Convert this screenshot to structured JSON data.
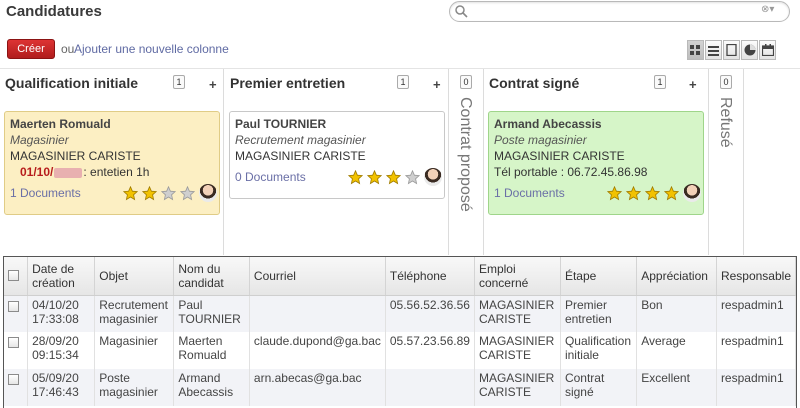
{
  "header": {
    "title": "Candidatures"
  },
  "search": {
    "placeholder": "",
    "dropdown_icon": "⊗▾"
  },
  "toolbar": {
    "create_label": "Créer",
    "or_label": "ou",
    "add_column_label": "Ajouter une nouvelle colonne",
    "views": [
      "kanban-icon",
      "list-icon",
      "form-icon",
      "graph-icon",
      "calendar-icon"
    ]
  },
  "columns": [
    {
      "title": "Qualification initiale",
      "count": "1"
    },
    {
      "title": "Premier entretien",
      "count": "1"
    },
    {
      "title": "Contrat proposé",
      "count": "0"
    },
    {
      "title": "Contrat signé",
      "count": "1"
    },
    {
      "title": "Refusé",
      "count": "0"
    }
  ],
  "cards": [
    {
      "name": "Maerten Romuald",
      "job": "Magasinier",
      "position": "MAGASINIER CARISTE",
      "date_prefix": "01/10/",
      "meeting": ": entetien 1h",
      "docs": "1 Documents",
      "rating": 2,
      "bg": "#fcefc3",
      "border": "#e0cc86"
    },
    {
      "name": "Paul TOURNIER",
      "job": "Recrutement magasinier",
      "position": "MAGASINIER CARISTE",
      "docs": "0 Documents",
      "rating": 3,
      "bg": "#ffffff",
      "border": "#c8c8c8"
    },
    {
      "name": "Armand Abecassis",
      "job": "Poste magasinier",
      "position": "MAGASINIER CARISTE",
      "phone": "Tél portable : 06.72.45.86.98",
      "docs": "1 Documents",
      "rating": 4,
      "bg": "#d6f5c8",
      "border": "#9fd58a"
    }
  ],
  "list": {
    "headers": [
      "Date de création",
      "Objet",
      "Nom du candidat",
      "Courriel",
      "Téléphone",
      "Emploi concerné",
      "Étape",
      "Appréciation",
      "Responsable"
    ],
    "rows": [
      [
        "04/10/20 17:33:08",
        "Recrutement magasinier",
        "Paul TOURNIER",
        "",
        "05.56.52.36.56",
        "MAGASINIER CARISTE",
        "Premier entretien",
        "Bon",
        "respadmin1"
      ],
      [
        "28/09/20 09:15:34",
        "Magasinier",
        "Maerten Romuald",
        "claude.dupond@ga.bac",
        "05.57.23.56.89",
        "MAGASINIER CARISTE",
        "Qualification initiale",
        "Average",
        "respadmin1"
      ],
      [
        "05/09/20 17:46:43",
        "Poste magasinier",
        "Armand Abecassis",
        "arn.abecas@ga.bac",
        "",
        "MAGASINIER CARISTE",
        "Contrat signé",
        "Excellent",
        "respadmin1"
      ]
    ]
  },
  "colors": {
    "create_button": "#c62828",
    "link": "#5f6aa3",
    "star_on": "#f2c200",
    "star_off": "#cfcfcf"
  }
}
